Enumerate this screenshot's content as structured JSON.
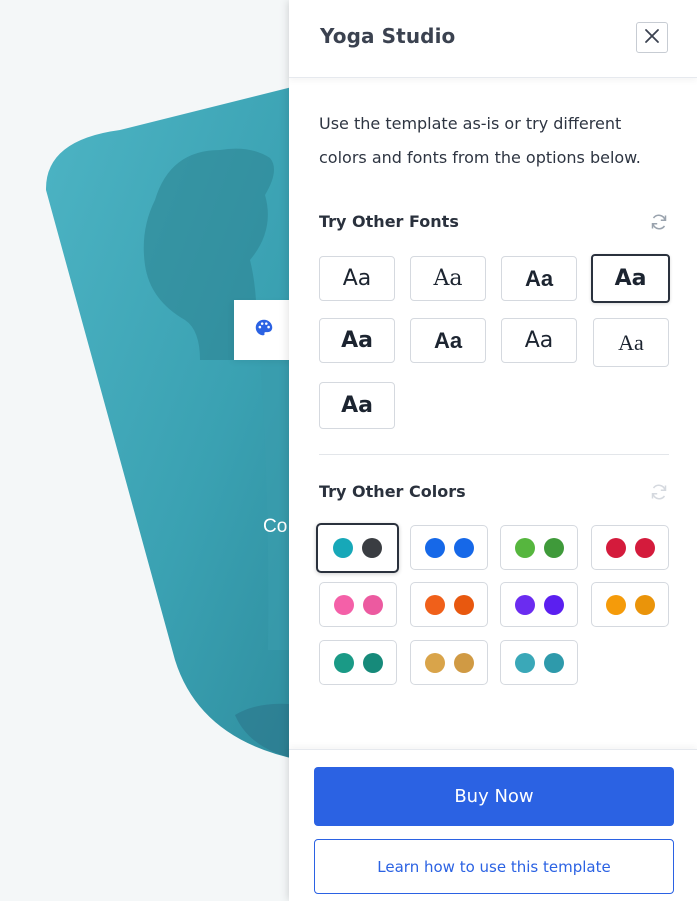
{
  "background": {
    "hero_text": "Co"
  },
  "panel": {
    "title": "Yoga Studio",
    "intro": "Use the template as-is or try different colors and fonts from the options below.",
    "fonts_section": {
      "title": "Try Other Fonts",
      "options": [
        "Aa",
        "Aa",
        "Aa",
        "Aa",
        "Aa",
        "Aa",
        "Aa",
        "Aa",
        "Aa"
      ],
      "selected_index": 3
    },
    "colors_section": {
      "title": "Try Other Colors",
      "swatches": [
        [
          "#17a8b8",
          "#3a3d42"
        ],
        [
          "#1668e8",
          "#1668e8"
        ],
        [
          "#56b63e",
          "#3f9a3a"
        ],
        [
          "#d41b3c",
          "#d41b3c"
        ],
        [
          "#f460a8",
          "#ec5aa0"
        ],
        [
          "#f0601a",
          "#e8580f"
        ],
        [
          "#6b2cf0",
          "#5b1ff0"
        ],
        [
          "#f59b0a",
          "#ea940a"
        ],
        [
          "#1a9a86",
          "#168a7a"
        ],
        [
          "#d9a44a",
          "#d09a44"
        ],
        [
          "#3aa8b8",
          "#2e9aab"
        ]
      ],
      "selected_index": 0
    },
    "buy_label": "Buy Now",
    "learn_label": "Learn how to use this template"
  }
}
